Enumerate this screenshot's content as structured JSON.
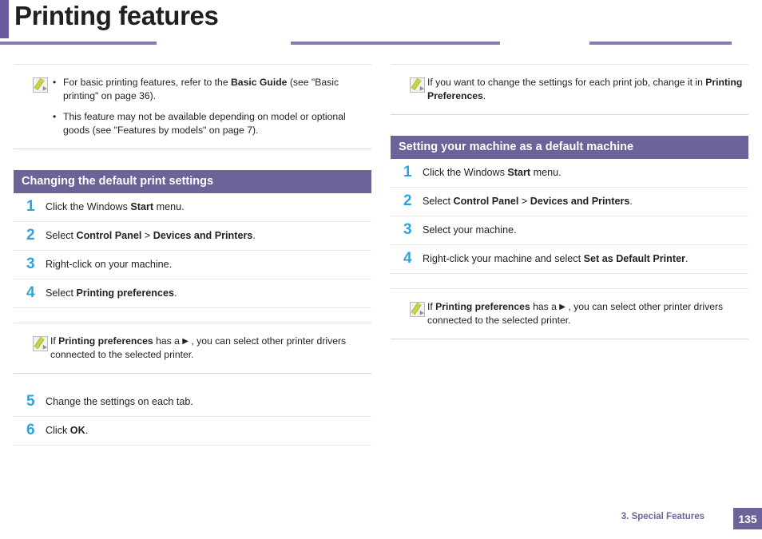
{
  "header": {
    "title": "Printing features",
    "accent_color": "#6b5a9e"
  },
  "left_column": {
    "note": {
      "icon": "note-pencil-icon",
      "items": [
        {
          "bullet": "•",
          "text_parts": [
            {
              "t": "For basic printing features, refer to the ",
              "b": false
            },
            {
              "t": "Basic Guide",
              "b": true
            },
            {
              "t": " (see \"Basic printing\" on page 36).",
              "b": false
            }
          ]
        },
        {
          "bullet": "•",
          "text_parts": [
            {
              "t": "This feature may not be available depending on model or optional goods (see \"Features by models\" on page 7).",
              "b": false
            }
          ]
        }
      ]
    },
    "section_title": "Changing the default print settings",
    "steps": [
      {
        "num": "1",
        "parts": [
          {
            "t": "Click the Windows ",
            "b": false
          },
          {
            "t": "Start",
            "b": true
          },
          {
            "t": " menu.",
            "b": false
          }
        ]
      },
      {
        "num": "2",
        "parts": [
          {
            "t": "Select ",
            "b": false
          },
          {
            "t": "Control Panel",
            "b": true
          },
          {
            "t": " > ",
            "b": false
          },
          {
            "t": "Devices and Printers",
            "b": true
          },
          {
            "t": ".",
            "b": false
          }
        ]
      },
      {
        "num": "3",
        "parts": [
          {
            "t": "Right-click on your machine.",
            "b": false
          }
        ]
      },
      {
        "num": "4",
        "parts": [
          {
            "t": "Select ",
            "b": false
          },
          {
            "t": "Printing preferences",
            "b": true
          },
          {
            "t": ".",
            "b": false
          }
        ]
      }
    ],
    "inline_note": {
      "icon": "note-pencil-icon",
      "parts": [
        {
          "t": "If ",
          "b": false
        },
        {
          "t": "Printing preferences",
          "b": true
        },
        {
          "t": " has a ",
          "b": false
        },
        {
          "t": "▶",
          "b": false,
          "arrow": true
        },
        {
          "t": " , you can select other printer drivers connected to the selected printer.",
          "b": false
        }
      ]
    },
    "steps_after": [
      {
        "num": "5",
        "parts": [
          {
            "t": "Change the settings on each tab.",
            "b": false
          }
        ]
      },
      {
        "num": "6",
        "parts": [
          {
            "t": "Click ",
            "b": false
          },
          {
            "t": "OK",
            "b": true
          },
          {
            "t": ".",
            "b": false
          }
        ]
      }
    ]
  },
  "right_column": {
    "note": {
      "icon": "note-pencil-icon",
      "parts": [
        {
          "t": "If you want to change the settings for each print job, change it in ",
          "b": false
        },
        {
          "t": "Printing Preferences",
          "b": true
        },
        {
          "t": ".",
          "b": false
        }
      ]
    },
    "section_title": "Setting your machine as a default machine",
    "steps": [
      {
        "num": "1",
        "parts": [
          {
            "t": "Click the Windows ",
            "b": false
          },
          {
            "t": "Start",
            "b": true
          },
          {
            "t": " menu.",
            "b": false
          }
        ]
      },
      {
        "num": "2",
        "parts": [
          {
            "t": "Select ",
            "b": false
          },
          {
            "t": "Control Panel",
            "b": true
          },
          {
            "t": " > ",
            "b": false
          },
          {
            "t": "Devices and Printers",
            "b": true
          },
          {
            "t": ".",
            "b": false
          }
        ]
      },
      {
        "num": "3",
        "parts": [
          {
            "t": "Select your machine.",
            "b": false
          }
        ]
      },
      {
        "num": "4",
        "parts": [
          {
            "t": "Right-click your machine and select ",
            "b": false
          },
          {
            "t": "Set as Default Printer",
            "b": true
          },
          {
            "t": ".",
            "b": false
          }
        ]
      }
    ],
    "inline_note": {
      "icon": "note-pencil-icon",
      "parts": [
        {
          "t": "If ",
          "b": false
        },
        {
          "t": "Printing preferences",
          "b": true
        },
        {
          "t": " has a ",
          "b": false
        },
        {
          "t": "▶",
          "b": false,
          "arrow": true
        },
        {
          "t": " , you can select other printer drivers connected to the selected printer.",
          "b": false
        }
      ]
    }
  },
  "footer": {
    "chapter": "3.  Special Features",
    "page_number": "135",
    "accent_color": "#6e6399"
  }
}
